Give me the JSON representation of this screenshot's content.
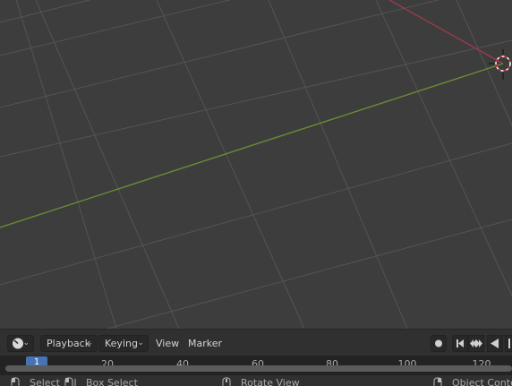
{
  "timeline": {
    "editor_icon": "clock-icon",
    "menus": {
      "playback": "Playback",
      "keying": "Keying",
      "view": "View",
      "marker": "Marker"
    },
    "transport_icons": [
      "record-icon",
      "jump-to-start-icon",
      "keyframe-jump-icon",
      "play-reverse-icon",
      "play-icon"
    ],
    "current_frame": "1",
    "ruler_ticks": [
      "20",
      "40",
      "60",
      "80",
      "100",
      "120"
    ]
  },
  "status": {
    "items": [
      {
        "label": "Select",
        "icon": "mouse-left-icon"
      },
      {
        "label": "Box Select",
        "icon": "mouse-drag-icon"
      },
      {
        "label": "Rotate View",
        "icon": "mouse-middle-icon"
      },
      {
        "label": "Object Context Menu",
        "icon": "mouse-right-icon"
      }
    ]
  },
  "colors": {
    "viewport_bg": "#3d3d3d",
    "grid_line": "#545454",
    "x_axis": "#9b3b4b",
    "y_axis": "#6a8c32",
    "accent": "#4772b3"
  }
}
